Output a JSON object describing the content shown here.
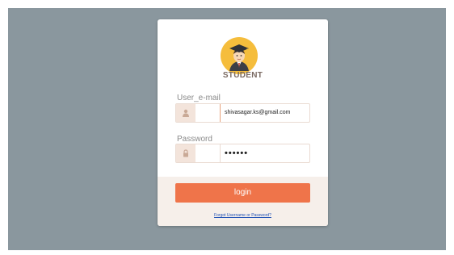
{
  "login": {
    "role_title": "STUDENT",
    "email_label": "User_e-mail",
    "email_value": "shivasagar.ks@gmail.com",
    "password_label": "Password",
    "password_value": "••••••",
    "login_button": "login",
    "forgot_link": "Forgot Username or Password?"
  },
  "icons": {
    "avatar": "student-graduate-avatar-icon",
    "email_addon": "user-icon",
    "password_addon": "lock-icon"
  },
  "colors": {
    "backdrop": "#8a979e",
    "accent": "#ef744a",
    "avatar_bg": "#f5bd3c",
    "addon_bg": "#f3e4db",
    "footer_bg": "#f6efea",
    "link": "#1f50b5"
  }
}
